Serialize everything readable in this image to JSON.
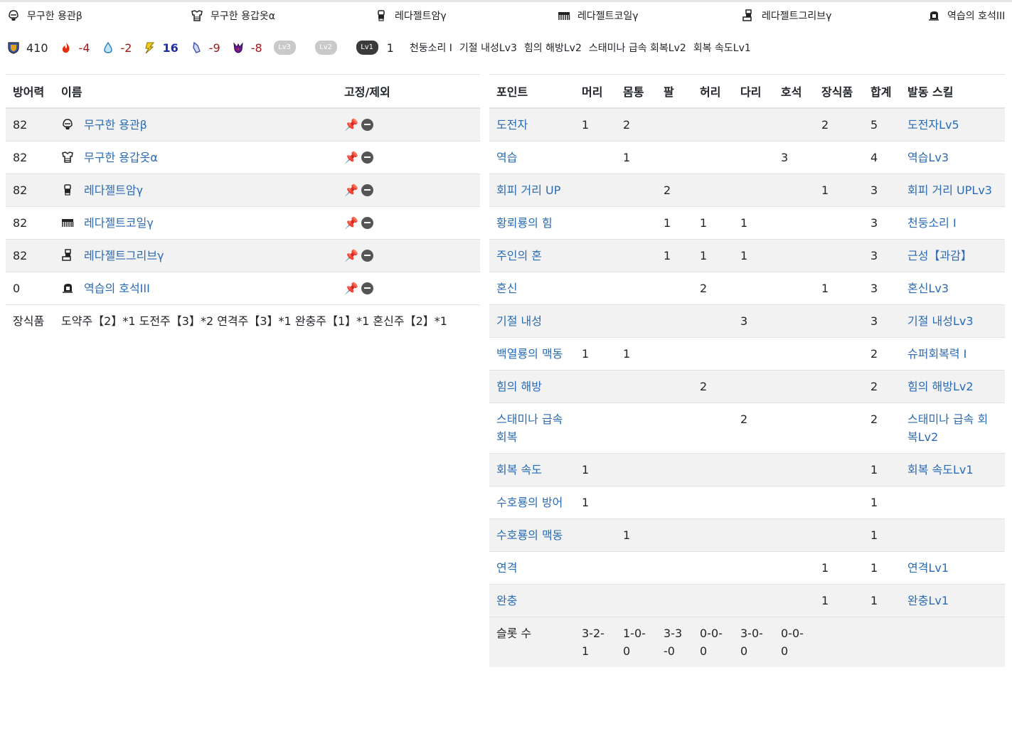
{
  "equipment": [
    {
      "icon": "helm-icon",
      "name": "무구한 용관β"
    },
    {
      "icon": "chest-icon",
      "name": "무구한 용갑옷α"
    },
    {
      "icon": "arm-icon",
      "name": "레다젤트암γ"
    },
    {
      "icon": "waist-icon",
      "name": "레다젤트코일γ"
    },
    {
      "icon": "leg-icon",
      "name": "레다젤트그리브γ"
    },
    {
      "icon": "charm-icon",
      "name": "역습의 호석III"
    }
  ],
  "stats": {
    "defense": "410",
    "fire": "-4",
    "water": "-2",
    "thunder": "16",
    "ice": "-9",
    "dragon": "-8",
    "slot_lv3": "Lv3",
    "slot_lv2": "Lv2",
    "slot_lv1": "Lv1",
    "slot_lv1_count": "1",
    "skills": [
      "천둥소리 I",
      "기절 내성Lv3",
      "힘의 해방Lv2",
      "스태미나 급속 회복Lv2",
      "회복 속도Lv1"
    ]
  },
  "armor_table": {
    "headers": {
      "defense": "방어력",
      "name": "이름",
      "fix": "고정/제외"
    },
    "rows": [
      {
        "defense": "82",
        "name": "무구한 용관β"
      },
      {
        "defense": "82",
        "name": "무구한 용갑옷α"
      },
      {
        "defense": "82",
        "name": "레다젤트암γ"
      },
      {
        "defense": "82",
        "name": "레다젤트코일γ"
      },
      {
        "defense": "82",
        "name": "레다젤트그리브γ"
      },
      {
        "defense": "0",
        "name": "역습의 호석III"
      }
    ],
    "decoration_label": "장식품",
    "decoration_value": "도약주【2】*1 도전주【3】*2 연격주【3】*1 완충주【1】*1 혼신주【2】*1"
  },
  "skill_table": {
    "headers": [
      "포인트",
      "머리",
      "몸통",
      "팔",
      "허리",
      "다리",
      "호석",
      "장식품",
      "합계",
      "발동 스킬"
    ],
    "rows": [
      {
        "point": "도전자",
        "head": "1",
        "body": "2",
        "arm": "",
        "waist": "",
        "leg": "",
        "charm": "",
        "deco": "2",
        "total": "5",
        "skill": "도전자Lv5"
      },
      {
        "point": "역습",
        "head": "",
        "body": "1",
        "arm": "",
        "waist": "",
        "leg": "",
        "charm": "3",
        "deco": "",
        "total": "4",
        "skill": "역습Lv3"
      },
      {
        "point": "회피 거리 UP",
        "head": "",
        "body": "",
        "arm": "2",
        "waist": "",
        "leg": "",
        "charm": "",
        "deco": "1",
        "total": "3",
        "skill": "회피 거리 UPLv3"
      },
      {
        "point": "황뢰룡의 힘",
        "head": "",
        "body": "",
        "arm": "1",
        "waist": "1",
        "leg": "1",
        "charm": "",
        "deco": "",
        "total": "3",
        "skill": "천둥소리 I"
      },
      {
        "point": "주인의 혼",
        "head": "",
        "body": "",
        "arm": "1",
        "waist": "1",
        "leg": "1",
        "charm": "",
        "deco": "",
        "total": "3",
        "skill": "근성【과감】"
      },
      {
        "point": "혼신",
        "head": "",
        "body": "",
        "arm": "",
        "waist": "2",
        "leg": "",
        "charm": "",
        "deco": "1",
        "total": "3",
        "skill": "혼신Lv3"
      },
      {
        "point": "기절 내성",
        "head": "",
        "body": "",
        "arm": "",
        "waist": "",
        "leg": "3",
        "charm": "",
        "deco": "",
        "total": "3",
        "skill": "기절 내성Lv3"
      },
      {
        "point": "백열룡의 맥동",
        "head": "1",
        "body": "1",
        "arm": "",
        "waist": "",
        "leg": "",
        "charm": "",
        "deco": "",
        "total": "2",
        "skill": "슈퍼회복력 I"
      },
      {
        "point": "힘의 해방",
        "head": "",
        "body": "",
        "arm": "",
        "waist": "2",
        "leg": "",
        "charm": "",
        "deco": "",
        "total": "2",
        "skill": "힘의 해방Lv2"
      },
      {
        "point": "스태미나 급속 회복",
        "head": "",
        "body": "",
        "arm": "",
        "waist": "",
        "leg": "2",
        "charm": "",
        "deco": "",
        "total": "2",
        "skill": "스태미나 급속 회복Lv2"
      },
      {
        "point": "회복 속도",
        "head": "1",
        "body": "",
        "arm": "",
        "waist": "",
        "leg": "",
        "charm": "",
        "deco": "",
        "total": "1",
        "skill": "회복 속도Lv1"
      },
      {
        "point": "수호룡의 방어",
        "head": "1",
        "body": "",
        "arm": "",
        "waist": "",
        "leg": "",
        "charm": "",
        "deco": "",
        "total": "1",
        "skill": ""
      },
      {
        "point": "수호룡의 맥동",
        "head": "",
        "body": "1",
        "arm": "",
        "waist": "",
        "leg": "",
        "charm": "",
        "deco": "",
        "total": "1",
        "skill": ""
      },
      {
        "point": "연격",
        "head": "",
        "body": "",
        "arm": "",
        "waist": "",
        "leg": "",
        "charm": "",
        "deco": "1",
        "total": "1",
        "skill": "연격Lv1"
      },
      {
        "point": "완충",
        "head": "",
        "body": "",
        "arm": "",
        "waist": "",
        "leg": "",
        "charm": "",
        "deco": "1",
        "total": "1",
        "skill": "완충Lv1"
      }
    ],
    "slot_row": {
      "label": "슬롯 수",
      "head": "3-2-1",
      "body": "1-0-0",
      "arm": "3-3-0",
      "waist": "0-0-0",
      "leg": "3-0-0",
      "charm": "0-0-0"
    }
  },
  "colors": {
    "link": "#2a6bb5",
    "negative": "#a11818",
    "thunder": "#1d2ea8",
    "stripe": "#f2f2f2"
  }
}
